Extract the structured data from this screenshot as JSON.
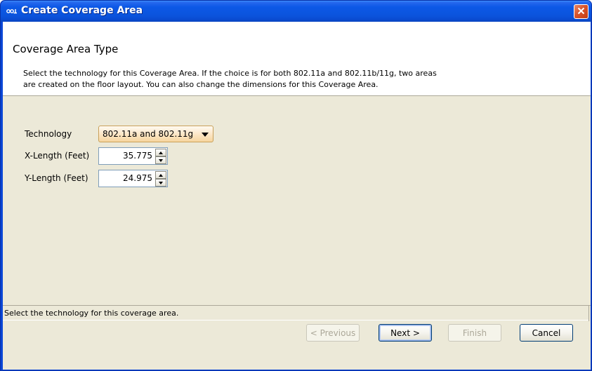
{
  "window": {
    "title": "Create Coverage Area",
    "app_icon": "cisco-app-icon",
    "close_icon": "close-icon"
  },
  "header": {
    "title": "Coverage Area Type",
    "description_line1": "Select the technology for this Coverage Area. If the choice is for both 802.11a and 802.11b/11g, two areas",
    "description_line2": "are created on the floor layout. You can also change the dimensions for this Coverage Area."
  },
  "form": {
    "technology_label": "Technology",
    "technology_value": "802.11a and 802.11g",
    "x_length_label": "X-Length (Feet)",
    "x_length_value": "35.775",
    "y_length_label": "Y-Length (Feet)",
    "y_length_value": "24.975"
  },
  "status": {
    "text": "Select the technology for this coverage area."
  },
  "buttons": {
    "previous": "< Previous",
    "next": "Next >",
    "finish": "Finish",
    "cancel": "Cancel"
  },
  "colors": {
    "titlebar": "#0a54dd",
    "dialog_bg": "#ece9d8",
    "close_button": "#d8542c",
    "dropdown_bg": "#fce7c8"
  }
}
